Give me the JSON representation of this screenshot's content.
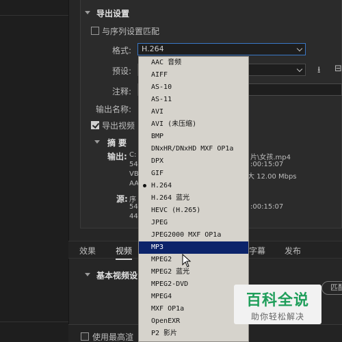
{
  "export_settings": {
    "section_title": "导出设置",
    "match_sequence_label": "与序列设置匹配",
    "format_label": "格式:",
    "format_value": "H.264",
    "preset_label": "预设:",
    "comments_label": "注释:",
    "output_name_label": "输出名称:",
    "export_video_label": "导出视频",
    "summary_title": "摘要",
    "output_label": "输出:",
    "output_lines": [
      "C:",
      "54",
      "VB",
      "AA"
    ],
    "output_right_lines": [
      "片\\女孩.mp4",
      ":00:15:07",
      "大 12.00 Mbps"
    ],
    "source_label": "源:",
    "source_lines": [
      "序",
      "54",
      "44"
    ],
    "source_right_lines": [
      ":00:15:07"
    ]
  },
  "tabs": [
    {
      "label": "效果"
    },
    {
      "label": "视频"
    },
    {
      "label": "字幕"
    },
    {
      "label": "发布"
    }
  ],
  "video_section": {
    "title": "基本视频设",
    "match_button_partial": "匹配"
  },
  "bottom": {
    "max_render_label": "使用最高渲"
  },
  "format_dropdown": {
    "items": [
      "AAC 音频",
      "AIFF",
      "AS-10",
      "AS-11",
      "AVI",
      "AVI (未压缩)",
      "BMP",
      "DNxHR/DNxHD MXF OP1a",
      "DPX",
      "GIF",
      "H.264",
      "H.264 蓝光",
      "HEVC (H.265)",
      "JPEG",
      "JPEG2000 MXF OP1a",
      "MP3",
      "MPEG2",
      "MPEG2 蓝光",
      "MPEG2-DVD",
      "MPEG4",
      "MXF OP1a",
      "OpenEXR",
      "P2 影片"
    ],
    "checked_item": "H.264",
    "highlighted_item": "MP3"
  },
  "watermark": {
    "title": "百科全说",
    "subtitle": "助你轻松解决"
  },
  "colors": {
    "selection": "#0c246a",
    "focus_border": "#3a78c8",
    "dropdown_bg": "#d6d3cc",
    "watermark_green": "#1f9e5a"
  }
}
